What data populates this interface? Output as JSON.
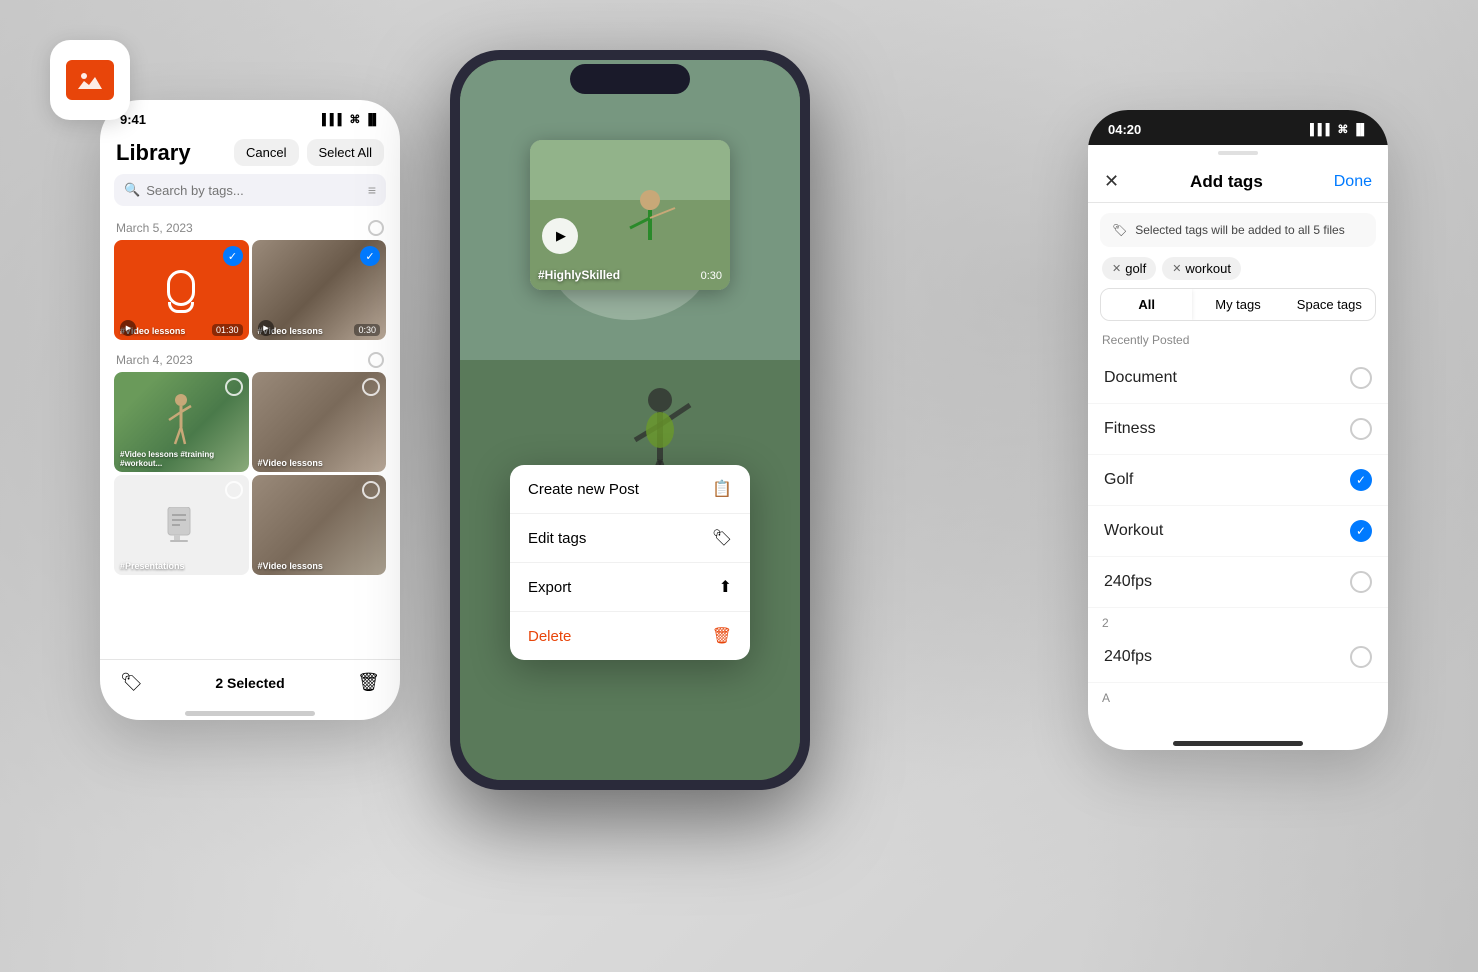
{
  "app": {
    "logo_alt": "App logo"
  },
  "phone_left": {
    "status_time": "9:41",
    "title": "Library",
    "btn_cancel": "Cancel",
    "btn_select_all": "Select All",
    "search_placeholder": "Search by tags...",
    "date1": "March 5, 2023",
    "date2": "March 4, 2023",
    "items": [
      {
        "label": "#Video lessons",
        "duration": "01:30",
        "selected": true,
        "type": "orange"
      },
      {
        "label": "#Video lessons",
        "duration": "0:30",
        "selected": true,
        "type": "iron"
      },
      {
        "label": "#Video lessons #training #workout...",
        "duration": "",
        "selected": false,
        "type": "golf"
      },
      {
        "label": "#Video lessons",
        "duration": "",
        "selected": false,
        "type": "iron2"
      },
      {
        "label": "#Presentations",
        "duration": "",
        "selected": false,
        "type": "doc"
      },
      {
        "label": "#Video lessons",
        "duration": "",
        "selected": false,
        "type": "iron3"
      }
    ],
    "bottom_selected": "2 Selected"
  },
  "phone_middle": {
    "video_label": "#HighlySkilled",
    "video_duration": "0:30",
    "menu": {
      "create_post": "Create new Post",
      "edit_tags": "Edit tags",
      "export": "Export",
      "delete": "Delete"
    }
  },
  "phone_right": {
    "status_time": "04:20",
    "title": "Add tags",
    "btn_done": "Done",
    "banner_text": "Selected tags will be added to all 5 files",
    "selected_tags": [
      "golf",
      "workout"
    ],
    "tabs": [
      "All",
      "My tags",
      "Space tags"
    ],
    "active_tab": "All",
    "section_recently": "Recently Posted",
    "tags": [
      {
        "name": "Document",
        "checked": false
      },
      {
        "name": "Fitness",
        "checked": false
      },
      {
        "name": "Golf",
        "checked": true
      },
      {
        "name": "Workout",
        "checked": true
      },
      {
        "name": "240fps",
        "checked": false
      }
    ],
    "section2": "2",
    "tags2": [
      {
        "name": "240fps",
        "checked": false
      }
    ],
    "section3": "A"
  }
}
